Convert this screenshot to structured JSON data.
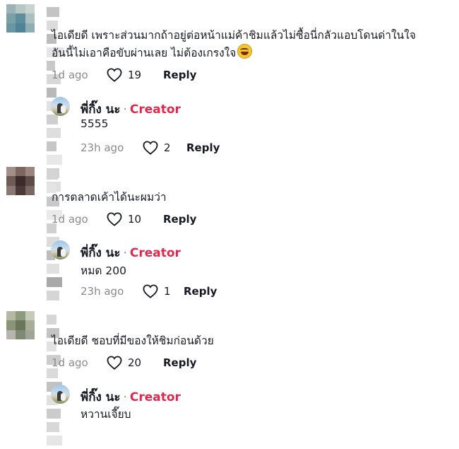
{
  "comments": [
    {
      "text_lines": [
        "ไอเดียดี เพราะส่วนมากถ้าอยู่ต่อหน้าแม่ค้าชิมแล้วไม่ซื้อนี่กลัวแอบโดนด่าในใจ",
        "อันนี้ไม่เอาคือขับผ่านเลย ไม่ต้องเกรงใจ"
      ],
      "emoji": "grinning-sweat-emoji",
      "time": "1d ago",
      "likes": "19",
      "reply_label": "Reply",
      "reply": {
        "author": "พี่กิ๊ง นะ",
        "separator": "·",
        "badge": "Creator",
        "text": "5555",
        "time": "23h ago",
        "likes": "2",
        "reply_label": "Reply"
      }
    },
    {
      "text_lines": [
        "การตลาดเค้าได้นะผมว่า"
      ],
      "time": "1d ago",
      "likes": "10",
      "reply_label": "Reply",
      "reply": {
        "author": "พี่กิ๊ง นะ",
        "separator": "·",
        "badge": "Creator",
        "text": "หมด 200",
        "time": "23h ago",
        "likes": "1",
        "reply_label": "Reply"
      }
    },
    {
      "text_lines": [
        "ไอเดียดี ชอบที่มีของให้ชิมก่อนด้วย"
      ],
      "time": "1d ago",
      "likes": "20",
      "reply_label": "Reply",
      "reply": {
        "author": "พี่กิ๊ง นะ",
        "separator": "·",
        "badge": "Creator",
        "text": "หวานเจี๊ยบ"
      }
    }
  ],
  "colors": {
    "creator_badge": "#e0284f",
    "secondary_text": "#8a8b91",
    "primary_text": "#161823"
  }
}
